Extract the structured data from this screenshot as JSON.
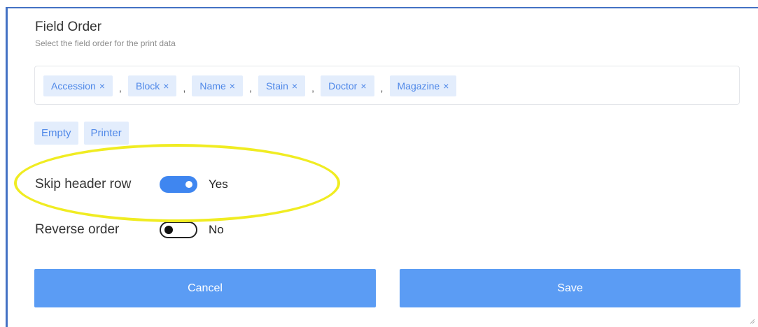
{
  "field_order": {
    "title": "Field Order",
    "subtitle": "Select the field order for the print data",
    "separator": ",",
    "remove_glyph": "×",
    "selected_tags": [
      {
        "label": "Accession"
      },
      {
        "label": "Block"
      },
      {
        "label": "Name"
      },
      {
        "label": "Stain"
      },
      {
        "label": "Doctor"
      },
      {
        "label": "Magazine"
      }
    ],
    "available_tags": [
      {
        "label": "Empty"
      },
      {
        "label": "Printer"
      }
    ]
  },
  "options": {
    "skip_header": {
      "label": "Skip header row",
      "state": "Yes",
      "on": true
    },
    "reverse_order": {
      "label": "Reverse order",
      "state": "No",
      "on": false
    }
  },
  "actions": {
    "cancel_label": "Cancel",
    "save_label": "Save"
  },
  "colors": {
    "accent": "#3f86f0",
    "button": "#5b9cf4",
    "tag_bg": "#e3edfc",
    "tag_text": "#4f88e8",
    "highlight": "#f0ec22",
    "frame_border": "#4472c4"
  },
  "icons": {
    "tag_remove": "close-icon",
    "corner": "resize-handle-icon"
  }
}
